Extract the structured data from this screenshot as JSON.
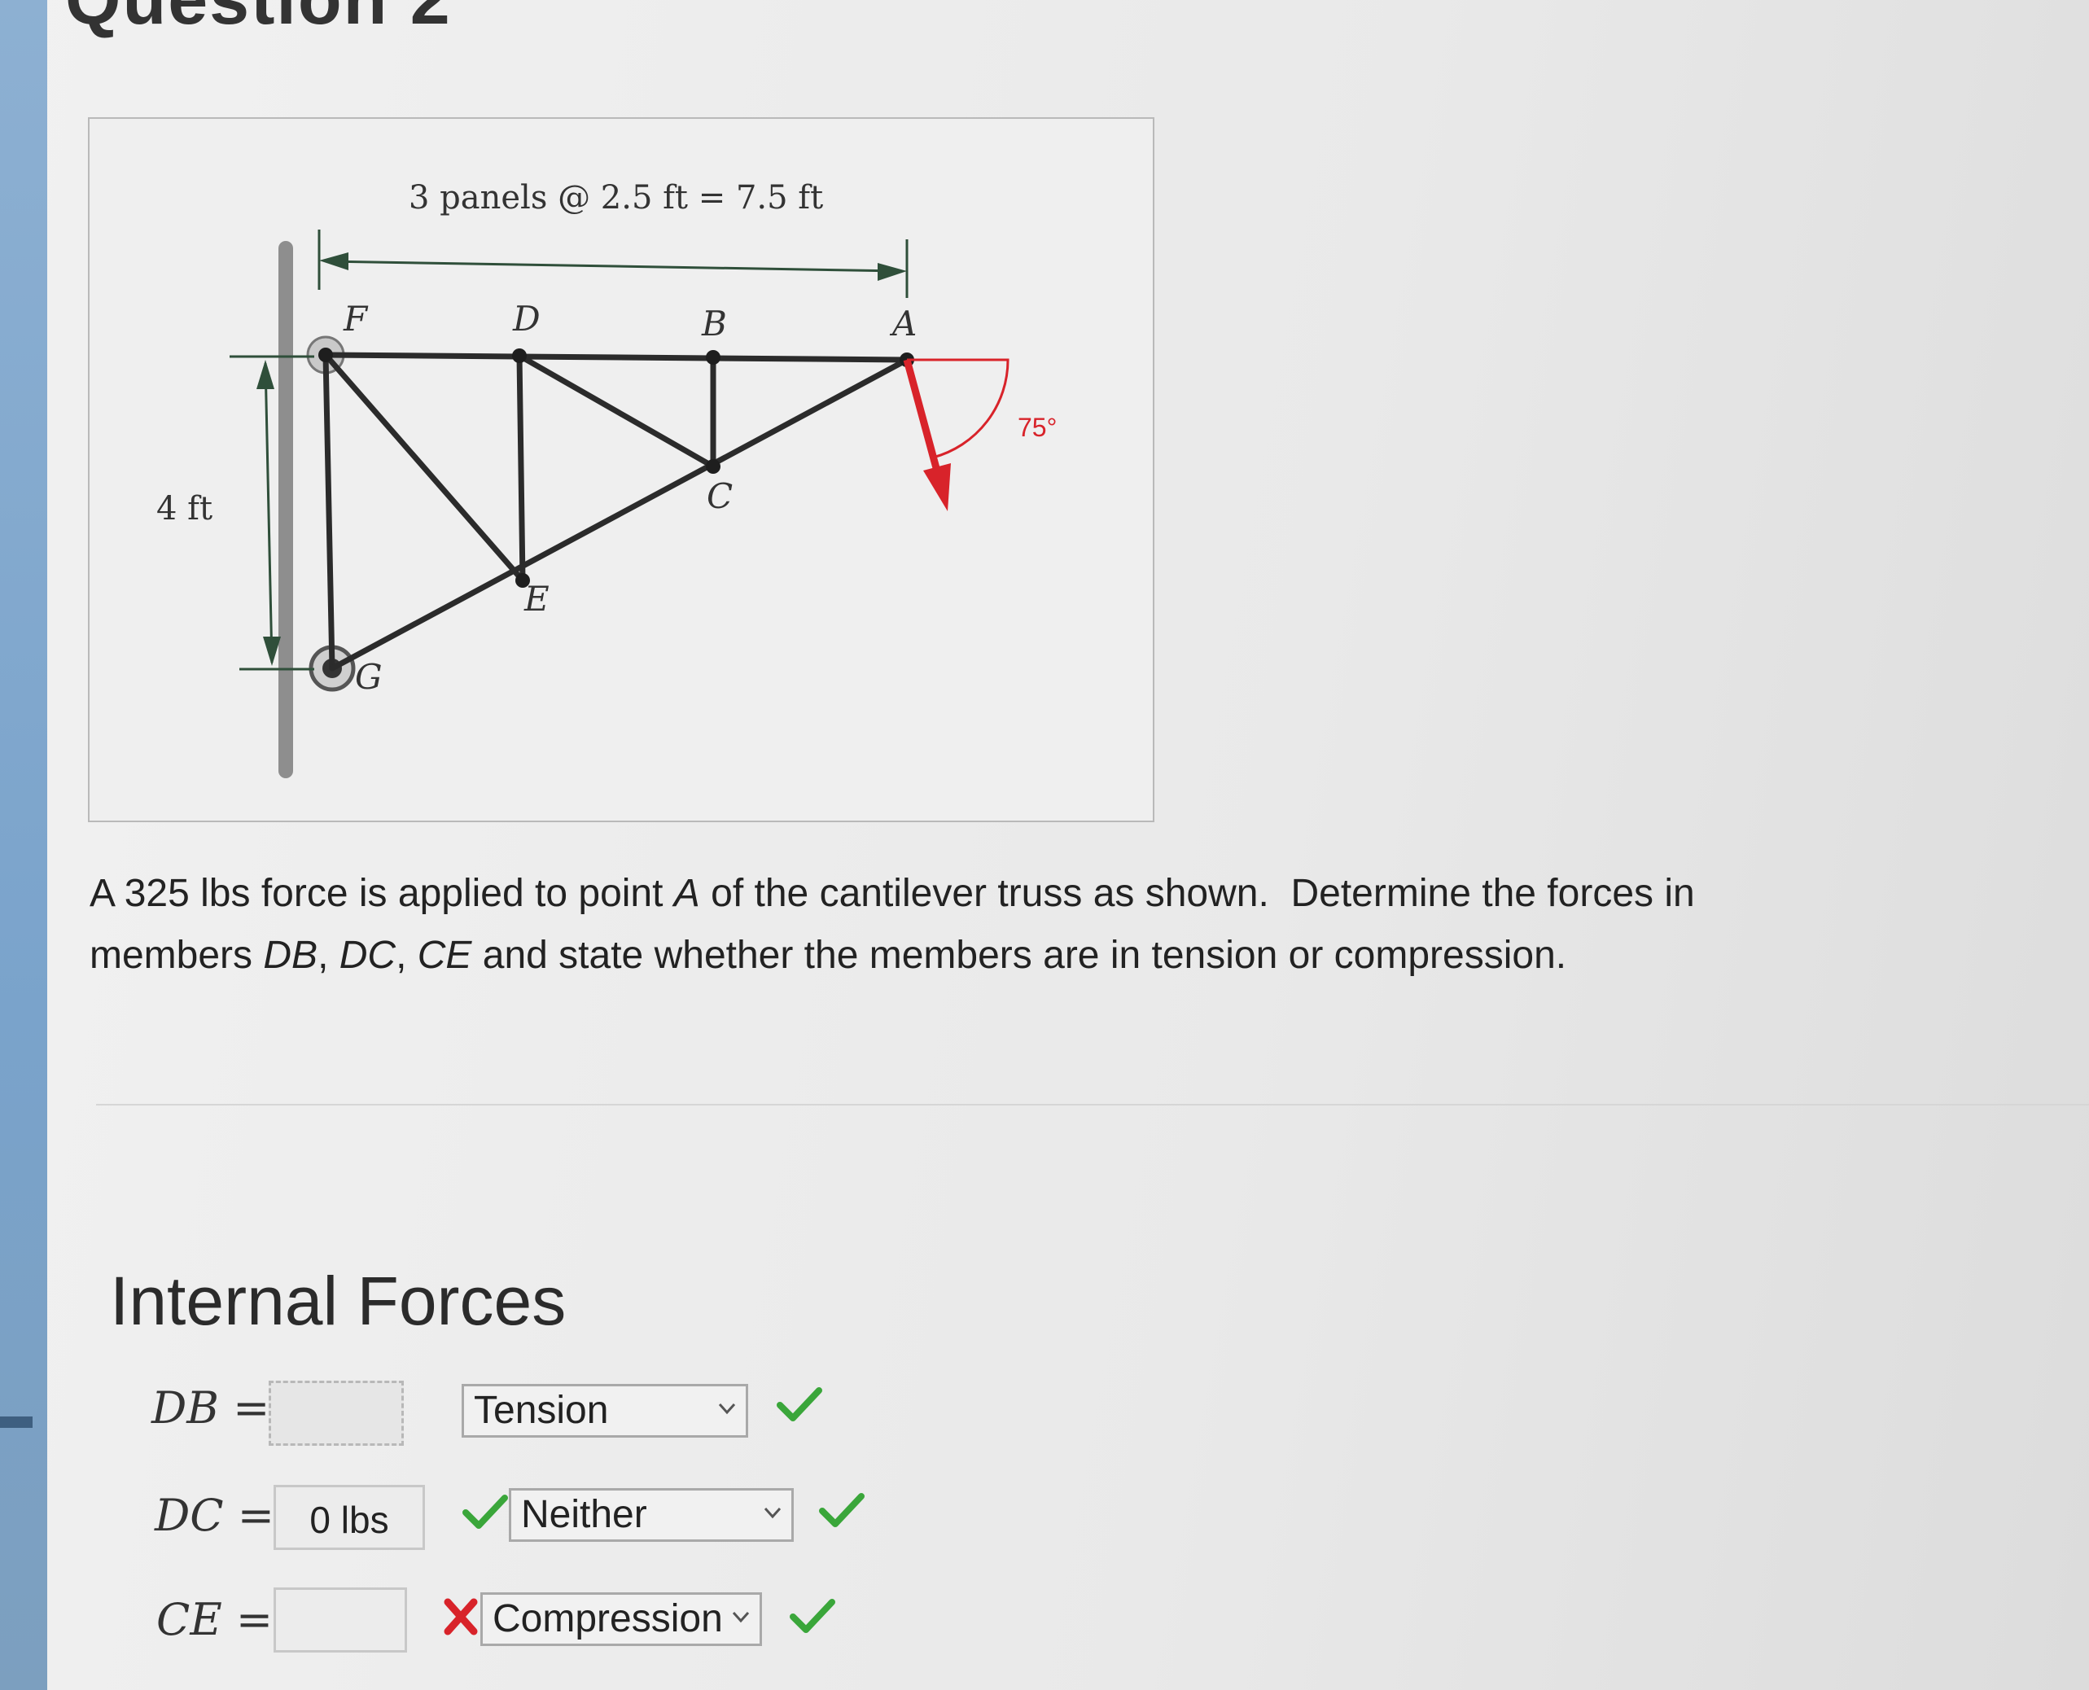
{
  "page": {
    "heading_fragment": "Question 2"
  },
  "figure": {
    "dimension_top": "3 panels @ 2.5 ft = 7.5 ft",
    "dimension_left": "4 ft",
    "angle_label": "75°",
    "node_labels": {
      "F": "F",
      "D": "D",
      "B": "B",
      "A": "A",
      "C": "C",
      "E": "E",
      "G": "G"
    },
    "colors": {
      "force": "#d8232a",
      "angle_arc": "#d8232a",
      "member": "#2b2b2b",
      "dim_line": "#2f4f3a"
    }
  },
  "problem": {
    "text_a": "A 325 lbs force is applied to point ",
    "point": "A",
    "text_b": " of the cantilever truss as shown.  Determine the forces in members ",
    "m1": "DB",
    "sep1": ", ",
    "m2": "DC",
    "sep2": ", ",
    "m3": "CE",
    "text_c": " and state whether the members are in tension or compression."
  },
  "section": {
    "title": "Internal Forces"
  },
  "answers": [
    {
      "label": "DB =",
      "value": "",
      "type_selected": "Tension",
      "value_status": "none",
      "type_status": "correct"
    },
    {
      "label": "DC =",
      "value": "0 lbs",
      "type_selected": "Neither",
      "value_status": "correct",
      "type_status": "correct"
    },
    {
      "label": "CE =",
      "value": "",
      "type_selected": "Compression",
      "value_status": "incorrect",
      "type_status": "correct"
    }
  ],
  "status_colors": {
    "correct": "#3aa63a",
    "incorrect": "#d8232a"
  }
}
